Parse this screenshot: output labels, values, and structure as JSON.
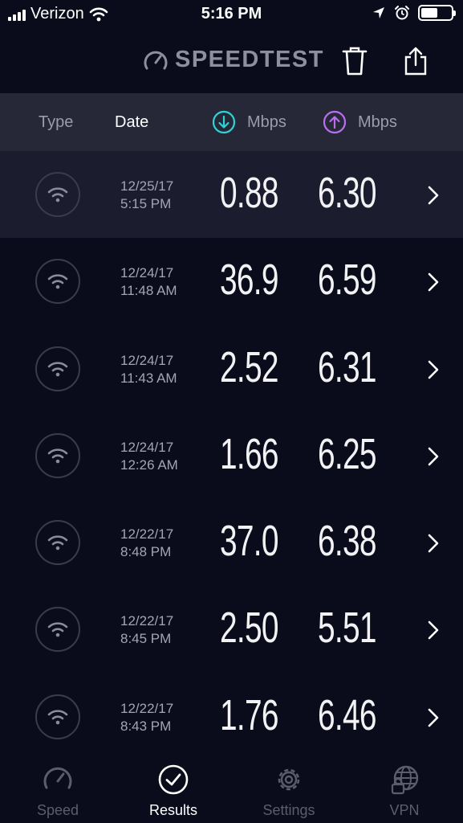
{
  "status_bar": {
    "carrier": "Verizon",
    "time": "5:16 PM"
  },
  "header": {
    "logo_text": "SPEEDTEST"
  },
  "columns": {
    "type": "Type",
    "date": "Date",
    "download_unit": "Mbps",
    "upload_unit": "Mbps",
    "download_color": "#2fd3d3",
    "upload_color": "#b86ef0"
  },
  "results": [
    {
      "date": "12/25/17",
      "time": "5:15 PM",
      "download": "0.88",
      "upload": "6.30",
      "connection_icon": "wifi-icon"
    },
    {
      "date": "12/24/17",
      "time": "11:48 AM",
      "download": "36.9",
      "upload": "6.59",
      "connection_icon": "wifi-icon"
    },
    {
      "date": "12/24/17",
      "time": "11:43 AM",
      "download": "2.52",
      "upload": "6.31",
      "connection_icon": "wifi-icon"
    },
    {
      "date": "12/24/17",
      "time": "12:26 AM",
      "download": "1.66",
      "upload": "6.25",
      "connection_icon": "wifi-icon"
    },
    {
      "date": "12/22/17",
      "time": "8:48 PM",
      "download": "37.0",
      "upload": "6.38",
      "connection_icon": "wifi-icon"
    },
    {
      "date": "12/22/17",
      "time": "8:45 PM",
      "download": "2.50",
      "upload": "5.51",
      "connection_icon": "wifi-icon"
    },
    {
      "date": "12/22/17",
      "time": "8:43 PM",
      "download": "1.76",
      "upload": "6.46",
      "connection_icon": "wifi-icon"
    }
  ],
  "tabs": [
    {
      "label": "Speed",
      "icon": "speedometer-icon",
      "active": false
    },
    {
      "label": "Results",
      "icon": "check-circle-icon",
      "active": true
    },
    {
      "label": "Settings",
      "icon": "gear-icon",
      "active": false
    },
    {
      "label": "VPN",
      "icon": "vpn-globe-lock-icon",
      "active": false
    }
  ]
}
